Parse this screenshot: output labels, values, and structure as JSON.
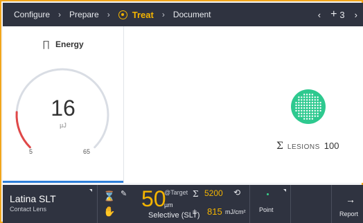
{
  "nav": {
    "steps": [
      {
        "label": "Configure",
        "sep": "›"
      },
      {
        "label": "Prepare",
        "sep": "›"
      },
      {
        "label": "Treat",
        "sep": "›"
      },
      {
        "label": "Document",
        "sep": ""
      }
    ],
    "prev_icon": "‹",
    "next_icon": "›",
    "spot_icon": "+",
    "spot_count": "3"
  },
  "energy": {
    "title": "Energy",
    "icon": "∏",
    "value": "16",
    "unit": "µJ",
    "min": "5",
    "max": "65",
    "level": 0.18
  },
  "lesions": {
    "sigma": "Σ",
    "label": "LESIONS",
    "value": "100"
  },
  "bottom": {
    "lens_name": "Latina SLT",
    "lens_type": "Contact Lens",
    "hourglass_icon": "⌛",
    "pen_icon": "✎",
    "hand_icon": "✋",
    "spot_size": "50",
    "spot_unit": "µm",
    "target_label": "@Target",
    "mode": "Selective (SLT)",
    "sum_icon": "Σ",
    "sum_value": "5200",
    "refresh_icon": "⟲",
    "fluence_icon": "±",
    "fluence_value": "815",
    "fluence_unit": "mJ/cm²",
    "point_label": "Point",
    "report_arrow": "→",
    "report_label": "Report"
  },
  "colors": {
    "accent": "#f4b400",
    "nav_bg": "#2f3340",
    "gauge_red": "#e04848",
    "gauge_track": "#d9dde4",
    "pattern_green": "#2ec98f",
    "frame_orange": "#f2a61c"
  }
}
